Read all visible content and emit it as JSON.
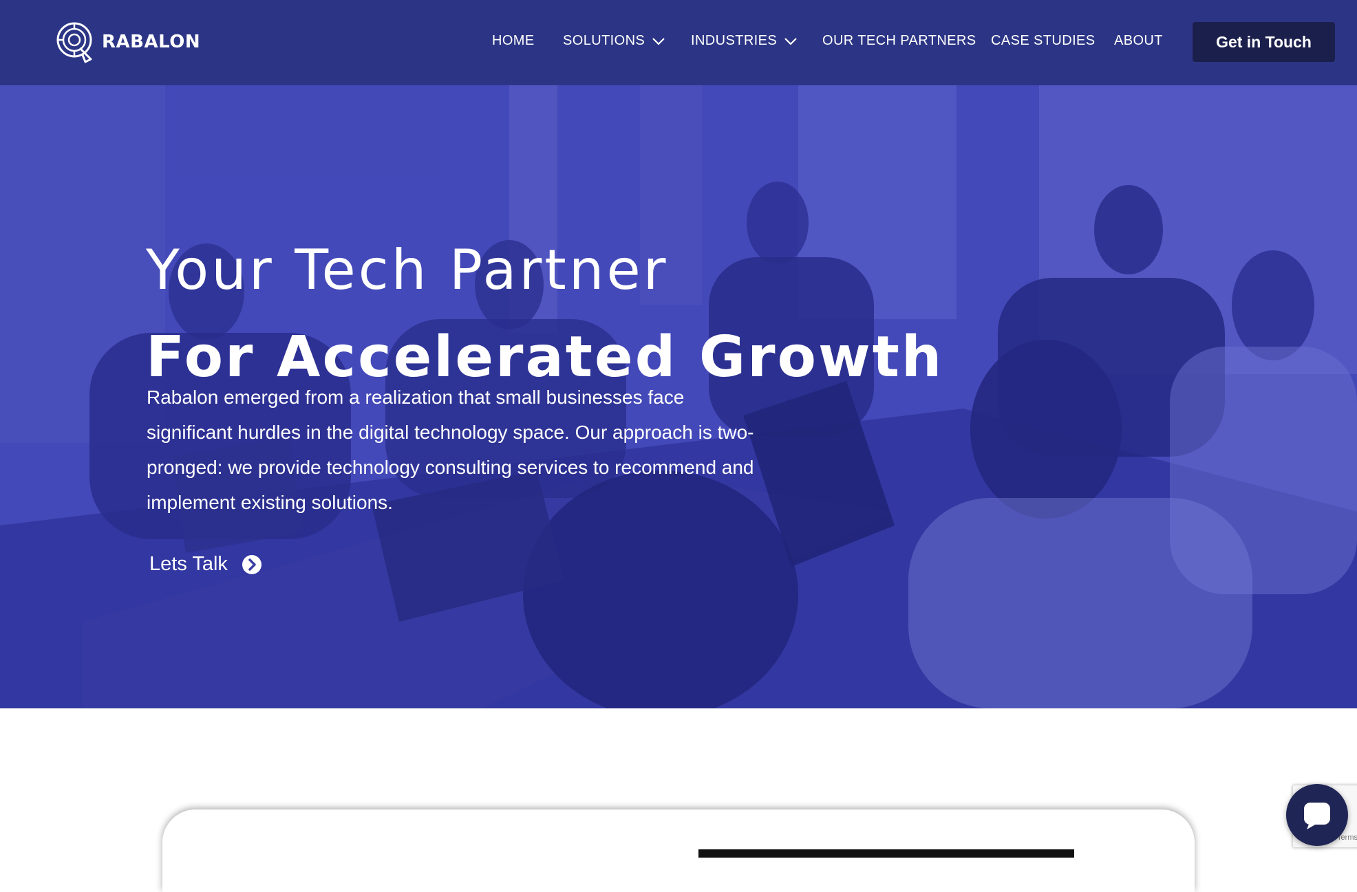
{
  "brand": {
    "name": "RABALON",
    "logo_icon": "rabalon-logo-icon"
  },
  "nav": {
    "home": "HOME",
    "solutions": "SOLUTIONS",
    "industries": "INDUSTRIES",
    "partners": "OUR TECH PARTNERS",
    "case_studies": "CASE STUDIES",
    "about": "ABOUT",
    "cta": "Get in Touch"
  },
  "hero": {
    "title_line1": "Your Tech Partner",
    "title_line2": "For Accelerated Growth",
    "description": "Rabalon emerged from a realization that small businesses face significant hurdles in the digital technology space. Our approach is two-pronged: we provide technology consulting services to recommend and implement existing solutions.",
    "cta_label": "Lets Talk",
    "cta_icon": "arrow-circle-right-icon"
  },
  "widgets": {
    "recaptcha_text": "Terms",
    "chat_icon": "chat-bubble-icon"
  },
  "colors": {
    "header_bg": "#2c3585",
    "cta_bg": "#1b1f4c",
    "hero_tint": "#3c42a5",
    "chat_bg": "#1f2555"
  }
}
